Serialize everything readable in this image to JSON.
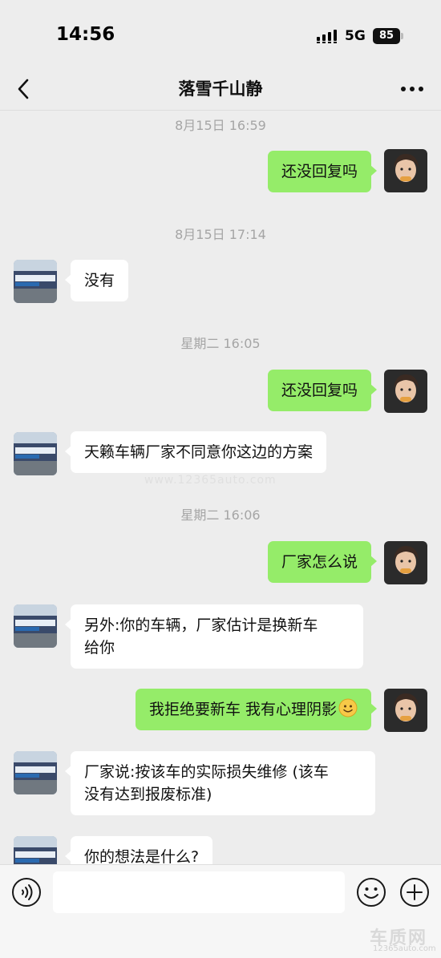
{
  "status_bar": {
    "time": "14:56",
    "network": "5G",
    "battery": "85"
  },
  "header": {
    "title": "落雪千山静"
  },
  "messages": [
    {
      "type": "timestamp",
      "text": "8月15日 16:59"
    },
    {
      "type": "out",
      "text": "还没回复吗"
    },
    {
      "type": "timestamp",
      "text": "8月15日 17:14"
    },
    {
      "type": "in",
      "text": "没有"
    },
    {
      "type": "timestamp",
      "text": "星期二 16:05"
    },
    {
      "type": "out",
      "text": "还没回复吗"
    },
    {
      "type": "in",
      "text": "天籁车辆厂家不同意你这边的方案"
    },
    {
      "type": "timestamp",
      "text": "星期二 16:06"
    },
    {
      "type": "out",
      "text": "厂家怎么说"
    },
    {
      "type": "in",
      "line1": "另外:你的车辆，厂家估计是换新车",
      "line2": "给你"
    },
    {
      "type": "out",
      "text": "我拒绝要新车 我有心理阴影",
      "emoji": "smiley-emoji"
    },
    {
      "type": "in",
      "line1": "厂家说:按该车的实际损失维修 (该车",
      "line2": "没有达到报废标准)"
    },
    {
      "type": "in",
      "text": "你的想法是什么?"
    }
  ],
  "watermark": "www.12365auto.com",
  "logo": {
    "name": "车质网",
    "url": "12365auto.com"
  },
  "input_bar": {
    "value": ""
  },
  "icons": {
    "back": "chevron-left-icon",
    "more": "more-dots-icon",
    "voice": "voice-icon",
    "emoji": "emoji-icon",
    "plus": "plus-icon"
  },
  "colors": {
    "background": "#ededed",
    "outgoing_bubble": "#95ec69",
    "incoming_bubble": "#ffffff",
    "timestamp": "#a5a5a5"
  }
}
